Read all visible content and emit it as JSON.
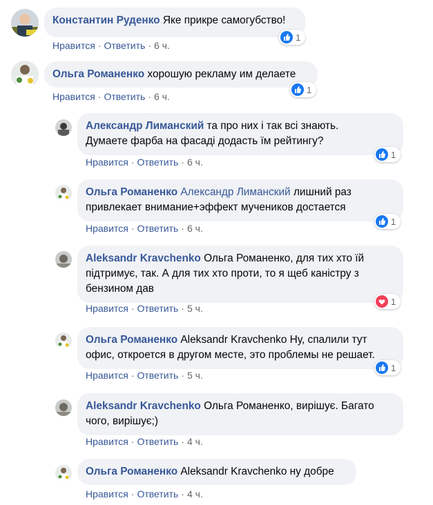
{
  "colors": {
    "link": "#385898",
    "bubble": "#f0f2f5",
    "meta": "#65676b",
    "like": "#1877f2",
    "love": "#f33e58"
  },
  "actions": {
    "like": "Нравится",
    "reply": "Ответить"
  },
  "comments": [
    {
      "author": "Константин Руденко",
      "text": " Яке прикре самогубство!",
      "time": "6 ч.",
      "reaction": "like-icon",
      "count": "1"
    },
    {
      "author": "Ольга Романенко",
      "text": " хорошую рекламу им делаете",
      "time": "6 ч.",
      "reaction": "like-icon",
      "count": "1"
    },
    {
      "author": "Александр Лиманский",
      "line1": " та про них і так всі знають.",
      "line2": "Думаете фарба на фасаді додасть їм рейтингу?",
      "time": "6 ч.",
      "reaction": "like-icon",
      "count": "1"
    },
    {
      "author": "Ольга Романенко",
      "mention": " Александр Лиманский",
      "line1": " лишний раз",
      "line2": "привлекает внимание+эффект мучеников достается",
      "time": "6 ч.",
      "reaction": "like-icon",
      "count": "1"
    },
    {
      "author": "Aleksandr Kravchenko",
      "line1": " Ольга Романенко, для тих хто їй",
      "line2": "підтримує, так. А для тих хто проти, то я щеб каністру з",
      "line3": "бензином дав",
      "time": "5 ч.",
      "reaction": "heart-icon",
      "count": "1"
    },
    {
      "author": "Ольга Романенко",
      "line1": " Aleksandr Kravchenko Ну, спалили тут",
      "line2": "офис, откроется в другом месте, это проблемы не решает.",
      "time": "5 ч.",
      "reaction": "like-icon",
      "count": "1"
    },
    {
      "author": "Aleksandr Kravchenko",
      "line1": " Ольга Романенко, вирішує. Багато",
      "line2": "чого, вирішує;)",
      "time": "4 ч."
    },
    {
      "author": "Ольга Романенко",
      "text": " Aleksandr Kravchenko ну добре",
      "time": "4 ч."
    }
  ]
}
